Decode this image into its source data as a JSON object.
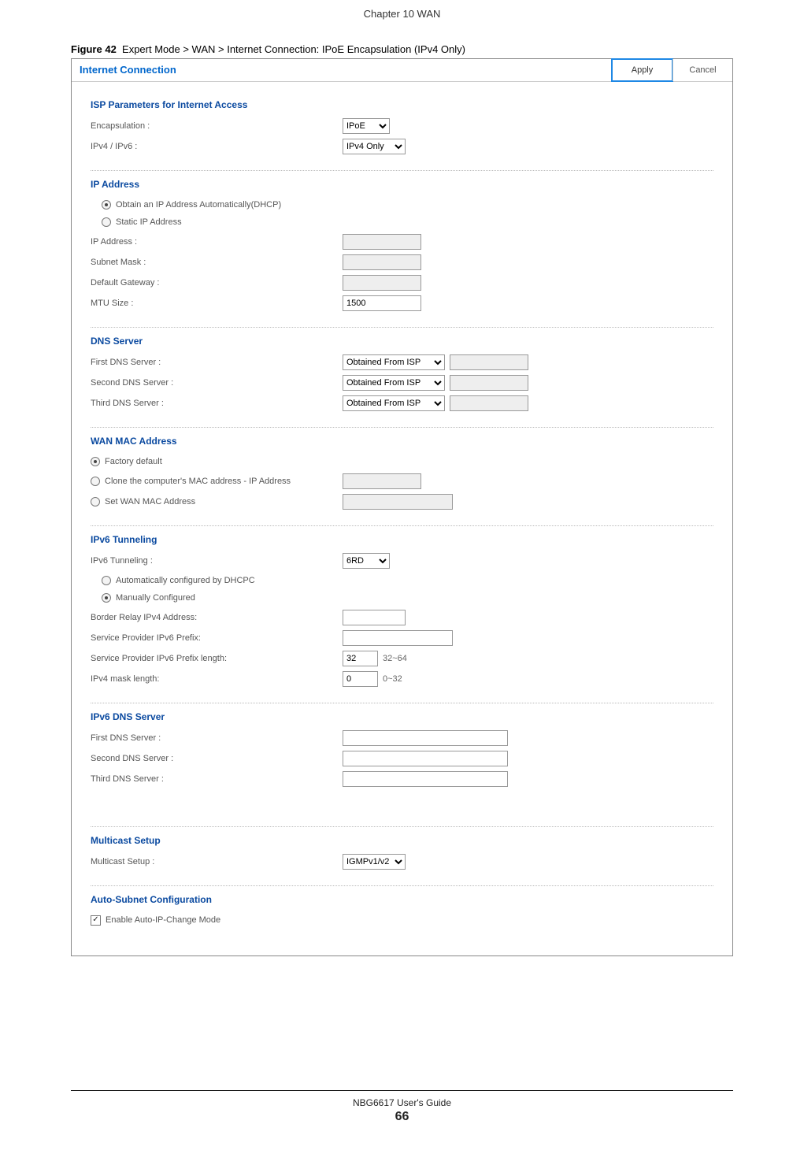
{
  "doc": {
    "chapter_header": "Chapter 10 WAN",
    "figure_label": "Figure 42",
    "figure_caption": "Expert Mode > WAN > Internet Connection: IPoE Encapsulation (IPv4 Only)",
    "footer_guide": "NBG6617 User's Guide",
    "page_number": "66"
  },
  "titlebar": {
    "title": "Internet Connection",
    "apply": "Apply",
    "cancel": "Cancel"
  },
  "isp": {
    "heading": "ISP Parameters for Internet Access",
    "encapsulation_label": "Encapsulation :",
    "encapsulation_value": "IPoE",
    "ipver_label": "IPv4 / IPv6 :",
    "ipver_value": "IPv4 Only"
  },
  "ipaddr": {
    "heading": "IP Address",
    "radio_dhcp": "Obtain an IP Address Automatically(DHCP)",
    "radio_static": "Static IP Address",
    "ip_label": "IP Address :",
    "subnet_label": "Subnet Mask :",
    "gateway_label": "Default Gateway :",
    "mtu_label": "MTU Size :",
    "mtu_value": "1500"
  },
  "dns": {
    "heading": "DNS Server",
    "first_label": "First DNS Server :",
    "second_label": "Second DNS Server :",
    "third_label": "Third DNS Server :",
    "option": "Obtained From ISP"
  },
  "mac": {
    "heading": "WAN MAC Address",
    "radio_factory": "Factory default",
    "radio_clone": "Clone the computer's MAC address - IP Address",
    "radio_set": "Set WAN MAC Address"
  },
  "tun": {
    "heading": "IPv6 Tunneling",
    "mode_label": "IPv6 Tunneling :",
    "mode_value": "6RD",
    "radio_auto": "Automatically configured by DHCPC",
    "radio_manual": "Manually Configured",
    "border_label": "Border Relay IPv4 Address:",
    "sp_prefix_label": "Service Provider IPv6 Prefix:",
    "sp_prefix_len_label": "Service Provider IPv6 Prefix length:",
    "sp_prefix_len_value": "32",
    "sp_prefix_len_hint": "32~64",
    "v4_mask_label": "IPv4 mask length:",
    "v4_mask_value": "0",
    "v4_mask_hint": "0~32"
  },
  "dns6": {
    "heading": "IPv6 DNS Server",
    "first_label": "First DNS Server :",
    "second_label": "Second DNS Server :",
    "third_label": "Third DNS Server :"
  },
  "mcast": {
    "heading": "Multicast Setup",
    "label": "Multicast Setup :",
    "value": "IGMPv1/v2"
  },
  "autosub": {
    "heading": "Auto-Subnet Configuration",
    "checkbox_label": "Enable Auto-IP-Change Mode"
  }
}
